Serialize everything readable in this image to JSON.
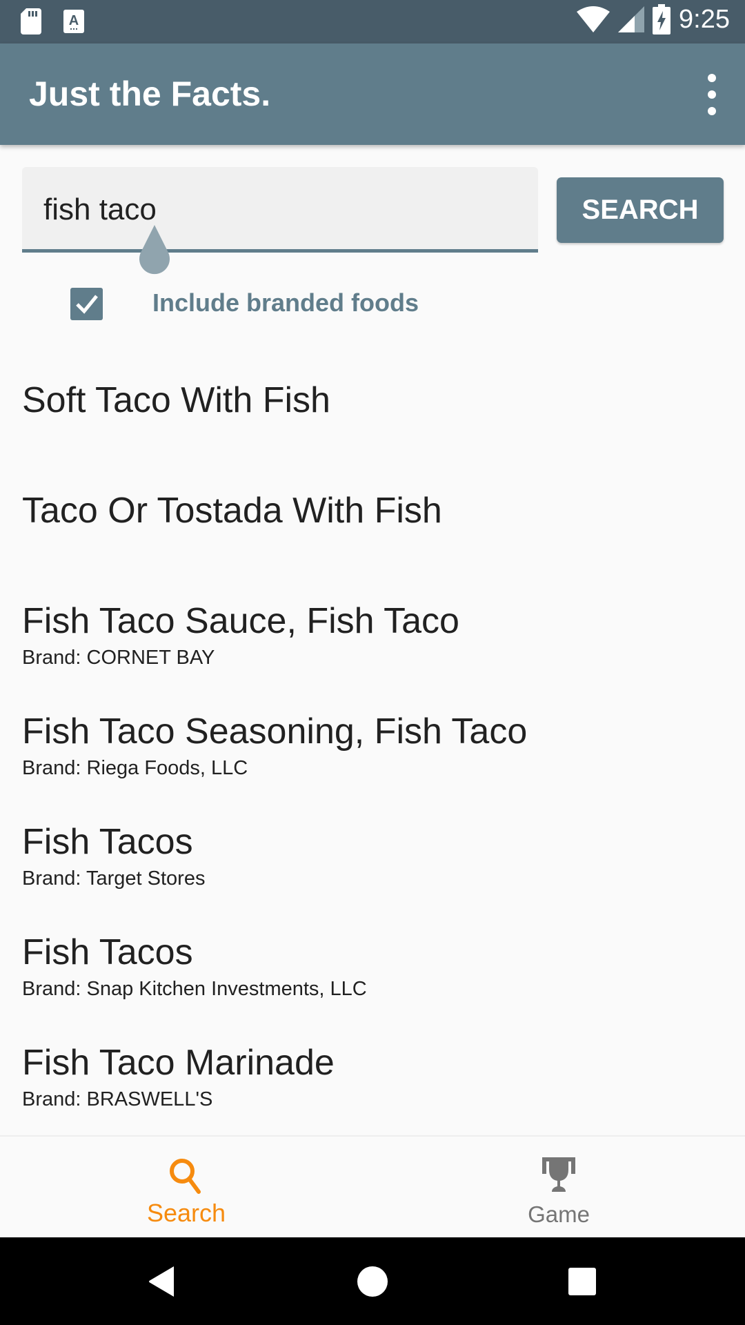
{
  "status_bar": {
    "time": "9:25",
    "left_icons": [
      "sd-card-icon",
      "keyboard-a-icon"
    ],
    "right_icons": [
      "wifi-icon",
      "signal-icon",
      "battery-charging-icon"
    ]
  },
  "app_bar": {
    "title": "Just the Facts.",
    "overflow_menu_icon": "more-vert-icon"
  },
  "search": {
    "query": "fish taco",
    "button_label": "SEARCH"
  },
  "filter": {
    "include_branded_label": "Include branded foods",
    "include_branded_checked": true
  },
  "results": [
    {
      "name": "Soft Taco With Fish",
      "brand": ""
    },
    {
      "name": "Taco Or Tostada With Fish",
      "brand": ""
    },
    {
      "name": "Fish Taco Sauce, Fish Taco",
      "brand": "Brand: CORNET BAY"
    },
    {
      "name": "Fish Taco Seasoning, Fish Taco",
      "brand": "Brand: Riega Foods, LLC"
    },
    {
      "name": "Fish Tacos",
      "brand": "Brand: Target Stores"
    },
    {
      "name": "Fish Tacos",
      "brand": "Brand: Snap Kitchen Investments, LLC"
    },
    {
      "name": "Fish Taco Marinade",
      "brand": "Brand: BRASWELL'S"
    }
  ],
  "bottom_nav": {
    "tabs": [
      {
        "label": "Search",
        "icon": "search-icon",
        "active": true
      },
      {
        "label": "Game",
        "icon": "trophy-icon",
        "active": false
      }
    ]
  },
  "colors": {
    "primary": "#607d8b",
    "primary_dark": "#485c69",
    "accent_active_tab": "#f68b0f",
    "inactive_tab": "#757575"
  }
}
